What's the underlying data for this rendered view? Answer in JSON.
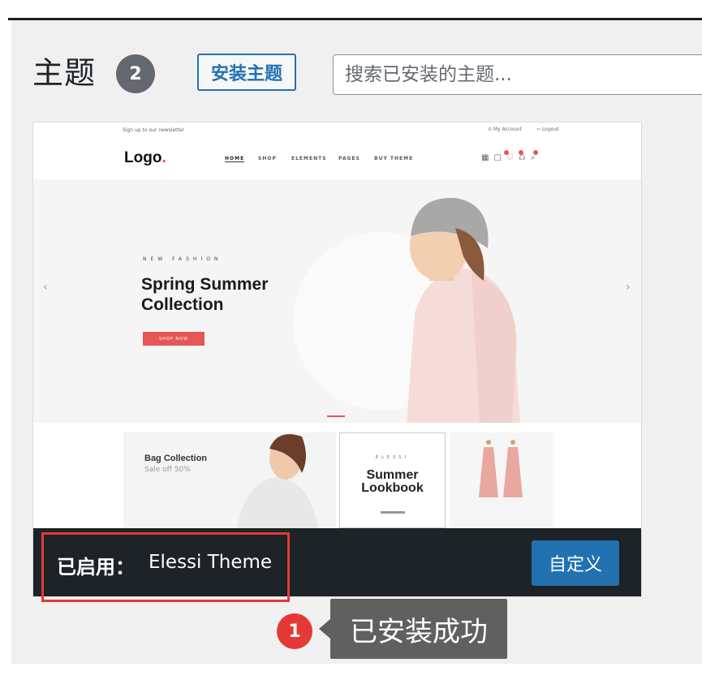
{
  "header": {
    "title": "主题",
    "count": "2",
    "add_button": "安装主题",
    "search_placeholder": "搜索已安装的主题..."
  },
  "theme_screenshot": {
    "newsletter": "Sign up to our newsletter",
    "my_account": "My Account",
    "logout": "Logout",
    "logo": "Logo",
    "logo_dot": ".",
    "nav": [
      "HOME",
      "SHOP",
      "ELEMENTS",
      "PAGES",
      "BUY THEME"
    ],
    "hero_small": "NEW FASHION",
    "hero_title_1": "Spring Summer",
    "hero_title_2": "Collection",
    "hero_button": "SHOP NOW",
    "prev_arrow": "‹",
    "next_arrow": "›",
    "tile1_title": "Bag Collection",
    "tile1_sub": "Sale off 50%",
    "tile2_brand": "ELESSI",
    "tile2_title_1": "Summer",
    "tile2_title_2": "Lookbook"
  },
  "card": {
    "active_label": "已启用：",
    "theme_name": "Elessi Theme",
    "customize_button": "自定义"
  },
  "annotation": {
    "step": "1",
    "tip": "已安装成功"
  },
  "colors": {
    "accent": "#2271b1",
    "dark_footer": "#1d2327",
    "highlight_red": "#e53935",
    "tooltip_gray": "#606060"
  }
}
